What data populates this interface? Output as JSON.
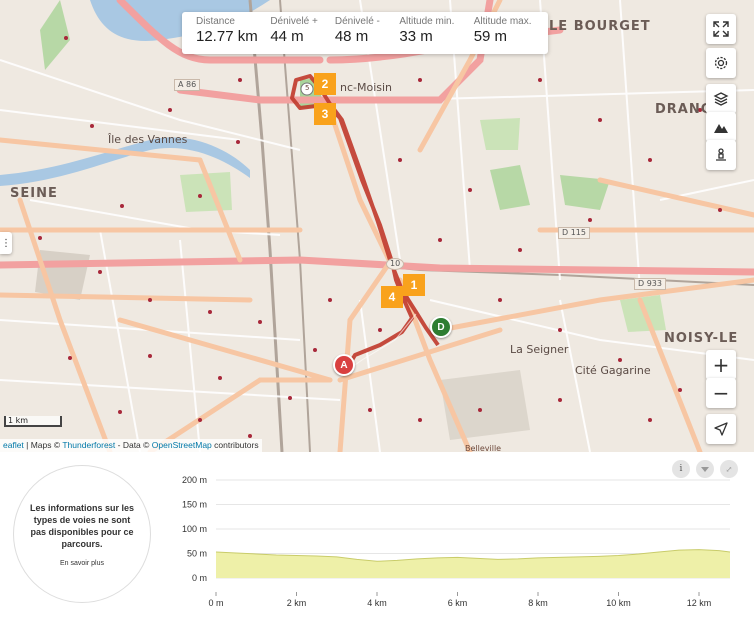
{
  "stats": [
    {
      "label": "Distance",
      "value": "12.77 km"
    },
    {
      "label": "Dénivelé +",
      "value": "44 m"
    },
    {
      "label": "Dénivelé -",
      "value": "48 m"
    },
    {
      "label": "Altitude min.",
      "value": "33 m"
    },
    {
      "label": "Altitude max.",
      "value": "59 m"
    }
  ],
  "map_labels": {
    "bourget": "LE BOURGET",
    "drancy": "DRANC",
    "seine": "SEINE",
    "noisy": "NOISY-LE",
    "ile_vannes": "Île des Vannes",
    "la_seigner": "La Seigner",
    "cite_gagarine": "Cité Gagarine",
    "denis": "nc-Moisin",
    "belleville": "Belleville"
  },
  "road_shields": {
    "a86": "A 86",
    "d115": "D 115",
    "d933": "D 933",
    "ten": "10"
  },
  "markers": {
    "waypoints": [
      "1",
      "2",
      "3",
      "4"
    ],
    "start": "A",
    "end": "D",
    "small": "5"
  },
  "side_buttons": [
    "expand-icon",
    "gear-icon",
    "layers-icon",
    "terrain-icon",
    "street-view-icon"
  ],
  "zoom": {
    "in": "+",
    "out": "−"
  },
  "locate": "locate-icon",
  "handle": "⋮",
  "scale": "1 km",
  "attribution": {
    "leaflet": "eaflet",
    "maps": " | Maps © ",
    "thunderforest": "Thunderforest",
    "data": " - Data © ",
    "osm": "OpenStreetMap",
    "contrib": " contributors"
  },
  "info": {
    "text": "Les informations sur les types de voies ne sont pas disponibles pour ce parcours.",
    "link": "En savoir plus"
  },
  "profile_buttons": {
    "info": "i",
    "download": "download-icon",
    "expand": "expand-icon"
  },
  "chart_data": {
    "type": "area",
    "title": "",
    "xlabel": "",
    "ylabel": "",
    "x_ticks": [
      "0 m",
      "2 km",
      "4 km",
      "6 km",
      "8 km",
      "10 km",
      "12 km"
    ],
    "y_ticks": [
      "0 m",
      "50 m",
      "100 m",
      "150 m",
      "200 m"
    ],
    "xlim": [
      0,
      12.77
    ],
    "ylim": [
      0,
      200
    ],
    "x": [
      0,
      0.5,
      1,
      1.5,
      2,
      2.5,
      3,
      3.5,
      4,
      4.5,
      5,
      5.5,
      6,
      6.5,
      7,
      7.5,
      8,
      8.5,
      9,
      9.5,
      10,
      10.5,
      11,
      11.5,
      12,
      12.5,
      12.77
    ],
    "y": [
      53,
      51,
      49,
      47,
      46,
      45,
      43,
      38,
      34,
      36,
      39,
      41,
      42,
      40,
      38,
      39,
      41,
      42,
      43,
      44,
      46,
      49,
      53,
      57,
      58,
      56,
      53
    ],
    "fill_color": "#eef0a8",
    "line_color": "#c9cc6a"
  }
}
